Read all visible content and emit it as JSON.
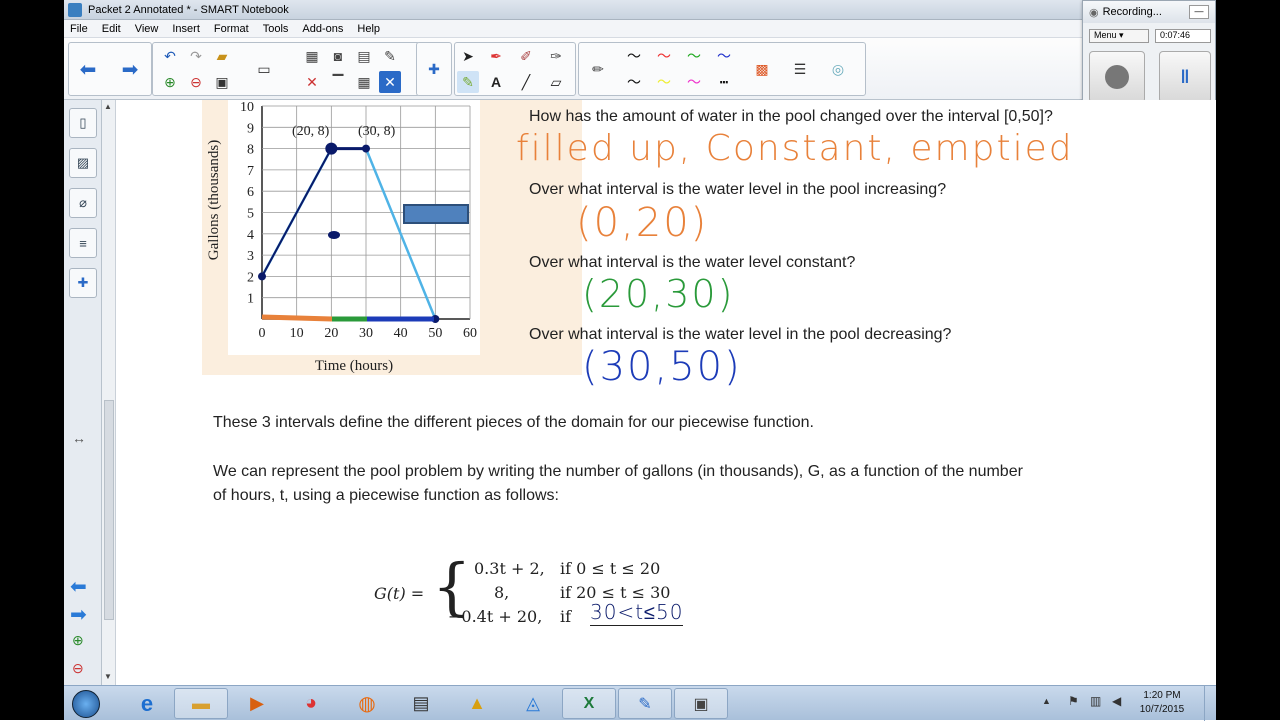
{
  "window": {
    "title": "Packet 2 Annotated * - SMART Notebook"
  },
  "menu": [
    "File",
    "Edit",
    "View",
    "Insert",
    "Format",
    "Tools",
    "Add-ons",
    "Help"
  ],
  "recording": {
    "status": "Recording...",
    "menu_label": "Menu",
    "time": "0:07:46"
  },
  "questions": {
    "q1": "How has the amount of water in the pool changed over the interval [0,50]?",
    "q2": "Over what interval is the water level in the pool increasing?",
    "q3": "Over what interval is the water level constant?",
    "q4": "Over what interval is the water level in the pool decreasing?"
  },
  "answers": {
    "a1": "filled up, Constant, emptied",
    "a2": "(0,20)",
    "a3": "(20,30)",
    "a4": "(30,50)"
  },
  "paragraphs": {
    "p1": "These 3 intervals define the different pieces of the domain for our piecewise function.",
    "p2a": "We can represent the pool problem by writing the number of gallons (in thousands), G, as a function of the number",
    "p2b": "of hours, t, using a piecewise function as follows:"
  },
  "formula": {
    "lhs": "G(t) =",
    "rows": [
      {
        "expr": "0.3t + 2,",
        "cond": "if 0 ≤ t ≤ 20"
      },
      {
        "expr": "8,",
        "cond": "if 20 ≤ t ≤ 30"
      },
      {
        "expr": "−0.4t + 20,",
        "cond": "if"
      }
    ],
    "handwritten_cond": "30<t≤50"
  },
  "chart_data": {
    "type": "line",
    "xlabel": "Time (hours)",
    "ylabel": "Gallons (thousands)",
    "x_ticks": [
      "0",
      "10",
      "20",
      "30",
      "40",
      "50",
      "60"
    ],
    "y_ticks": [
      "1",
      "2",
      "3",
      "4",
      "5",
      "6",
      "7",
      "8",
      "9",
      "10"
    ],
    "xlim": [
      0,
      60
    ],
    "ylim": [
      0,
      10
    ],
    "points": [
      {
        "x": 0,
        "y": 2
      },
      {
        "x": 20,
        "y": 8
      },
      {
        "x": 30,
        "y": 8
      },
      {
        "x": 50,
        "y": 0
      }
    ],
    "annotations": [
      "(20, 8)",
      "(30, 8)"
    ],
    "grid": true
  },
  "taskbar": {
    "time": "1:20 PM",
    "date": "10/7/2015"
  },
  "colors": {
    "answer1": "#e8813a",
    "answer2": "#e8813a",
    "answer3": "#2a9a3a",
    "answer4": "#1c3bb8",
    "line": "#4fb3e6"
  }
}
